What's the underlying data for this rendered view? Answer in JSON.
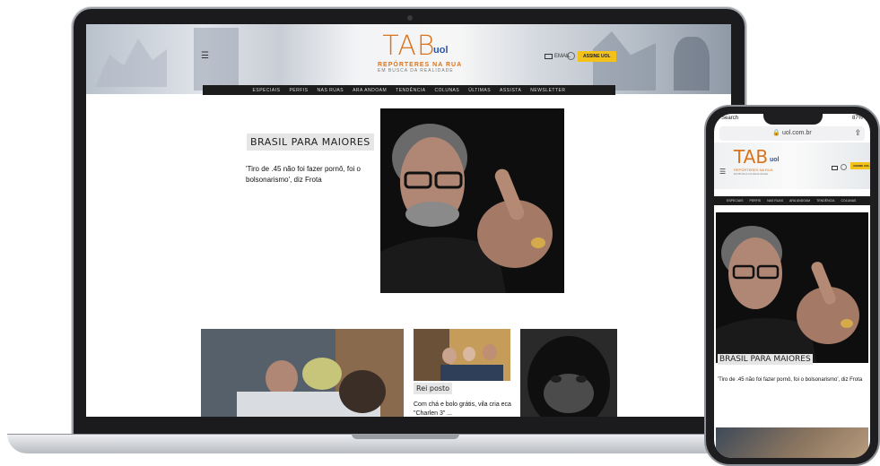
{
  "site": {
    "logo_main": "TAB",
    "logo_brand": "uol",
    "tagline": "REPÓRTERES NA RUA",
    "tagline_sub": "EM BUSCA DA REALIDADE",
    "email_label": "EMAIL",
    "subscribe_label": "ASSINE UOL"
  },
  "nav": {
    "items": [
      "ESPECIAIS",
      "PERFIS",
      "NAS RUAS",
      "ARA ANDOAM",
      "TENDÊNCIA",
      "COLUNAS",
      "ÚLTIMAS",
      "ASSISTA",
      "NEWSLETTER"
    ]
  },
  "hero": {
    "kicker": "BRASIL PARA MAIORES",
    "title": "'Tiro de .45 não foi fazer pornô, foi o bolsonarismo', diz Frota"
  },
  "tiles": {
    "second_kicker": "Rei posto",
    "second_title": "Com chá e bolo grátis, vila cria eca \"Charlen 3\" ..."
  },
  "phone": {
    "carrier": "Search",
    "battery": "87%",
    "url": "uol.com.br",
    "kicker": "BRASIL PARA MAIORES",
    "title": "'Tiro de .45 não foi fazer pornô, foi o bolsonarismo', diz Frota"
  },
  "colors": {
    "brand_orange": "#d9731c",
    "uol_blue": "#2a56a8",
    "subscribe_yellow": "#f2c21b",
    "nav_bg": "#1c1c1c"
  },
  "icons": [
    "hamburger-icon",
    "envelope-icon",
    "user-icon",
    "lock-icon",
    "share-icon",
    "camera-icon"
  ]
}
